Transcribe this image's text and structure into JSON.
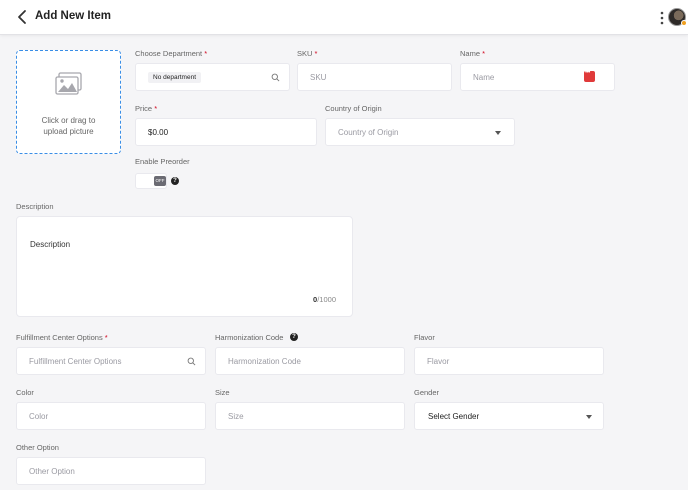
{
  "header": {
    "title": "Add New Item"
  },
  "upload": {
    "text": "Click or drag to upload picture"
  },
  "department": {
    "label": "Choose Department",
    "value": "No department"
  },
  "sku": {
    "label": "SKU",
    "placeholder": "SKU"
  },
  "name": {
    "label": "Name",
    "placeholder": "Name"
  },
  "price": {
    "label": "Price",
    "value": "$0.00"
  },
  "country": {
    "label": "Country of Origin",
    "placeholder": "Country of Origin"
  },
  "preorder": {
    "label": "Enable Preorder",
    "state": "OFF"
  },
  "description": {
    "label": "Description",
    "placeholder": "Description",
    "count": "0",
    "max": "/1000"
  },
  "fulfillment": {
    "label": "Fulfillment Center Options",
    "placeholder": "Fulfillment Center Options"
  },
  "harmonization": {
    "label": "Harmonization Code",
    "placeholder": "Harmonization Code"
  },
  "flavor": {
    "label": "Flavor",
    "placeholder": "Flavor"
  },
  "color": {
    "label": "Color",
    "placeholder": "Color"
  },
  "size": {
    "label": "Size",
    "placeholder": "Size"
  },
  "gender": {
    "label": "Gender",
    "value": "Select Gender"
  },
  "other": {
    "label": "Other Option",
    "placeholder": "Other Option"
  },
  "colors": {
    "accent": "#3a8ee6",
    "required": "#d0021b"
  }
}
